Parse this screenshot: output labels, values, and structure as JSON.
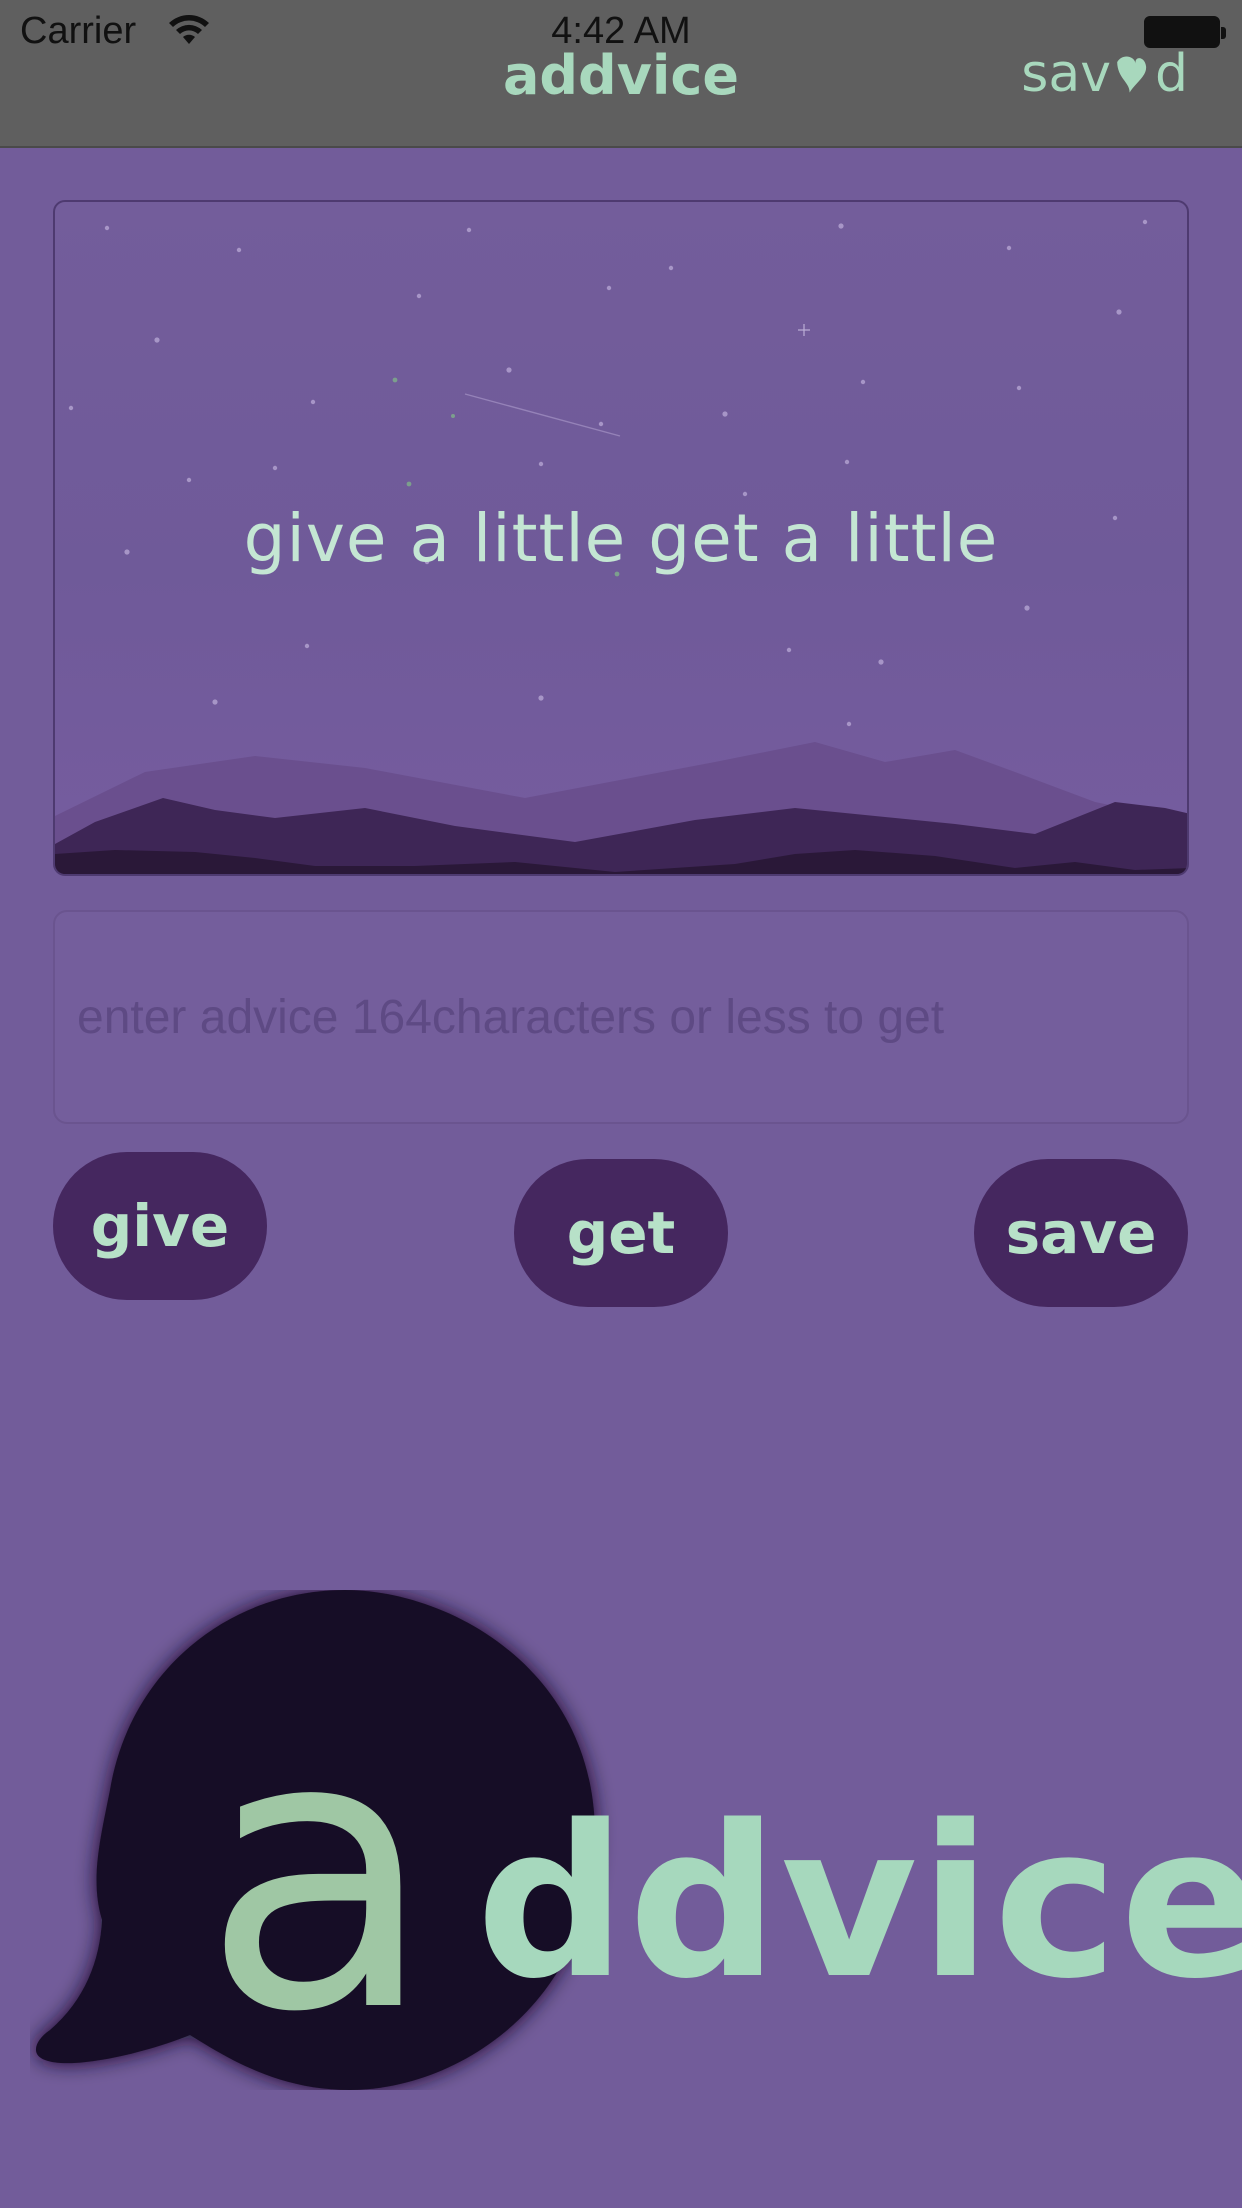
{
  "status_bar": {
    "carrier": "Carrier",
    "time": "4:42 AM"
  },
  "nav": {
    "title": "addvice",
    "saved_prefix": "sav",
    "saved_suffix": "d"
  },
  "hero": {
    "tagline": "give a little get a little"
  },
  "advice_input": {
    "placeholder": "enter advice 164characters or less to get",
    "value": ""
  },
  "buttons": {
    "give": "give",
    "get": "get",
    "save": "save"
  },
  "logo": {
    "letter": "a",
    "word": "ddvice"
  },
  "colors": {
    "background": "#725c9a",
    "nav_bar": "#5f5f5f",
    "accent_text": "#a8d8bd",
    "button": "#45275f",
    "logo_bubble": "#190b26"
  }
}
